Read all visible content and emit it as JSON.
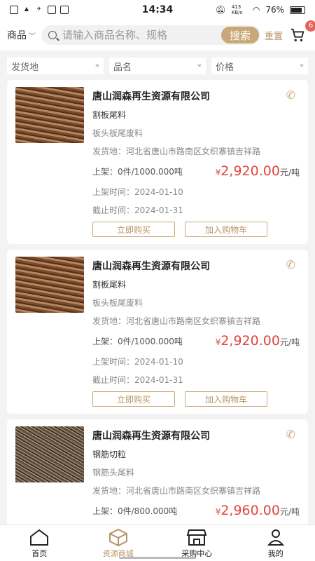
{
  "status": {
    "time": "14:34",
    "net": "413 KB/s",
    "battery": "76%"
  },
  "search": {
    "category": "商品",
    "placeholder": "请输入商品名称、规格",
    "search_label": "搜索",
    "reset_label": "重置",
    "cart_count": "6"
  },
  "filters": [
    {
      "label": "发货地"
    },
    {
      "label": "品名"
    },
    {
      "label": "价格"
    }
  ],
  "items": [
    {
      "company": "唐山润森再生资源有限公司",
      "name": "割板尾料",
      "category": "板头板尾废料",
      "origin": "发货地：河北省唐山市路南区女织寨镇吉祥路",
      "qty": "上架：0件/1000.000吨",
      "currency": "¥",
      "price": "2,920.00",
      "unit": "元/吨",
      "listed": "上架时间：2024-01-10",
      "deadline": "截止时间：2024-01-31",
      "buy_label": "立即购买",
      "cart_label": "加入购物车"
    },
    {
      "company": "唐山润森再生资源有限公司",
      "name": "割板尾料",
      "category": "板头板尾废料",
      "origin": "发货地：河北省唐山市路南区女织寨镇吉祥路",
      "qty": "上架：0件/1000.000吨",
      "currency": "¥",
      "price": "2,920.00",
      "unit": "元/吨",
      "listed": "上架时间：2024-01-10",
      "deadline": "截止时间：2024-01-31",
      "buy_label": "立即购买",
      "cart_label": "加入购物车"
    },
    {
      "company": "唐山润森再生资源有限公司",
      "name": "钢筋切粒",
      "category": "钢筋头尾料",
      "origin": "发货地：河北省唐山市路南区女织寨镇吉祥路",
      "qty": "上架：0件/800.000吨",
      "currency": "¥",
      "price": "2,960.00",
      "unit": "元/吨"
    }
  ],
  "tabs": [
    {
      "label": "首页"
    },
    {
      "label": "资源商城"
    },
    {
      "label": "采购中心"
    },
    {
      "label": "我的"
    }
  ]
}
